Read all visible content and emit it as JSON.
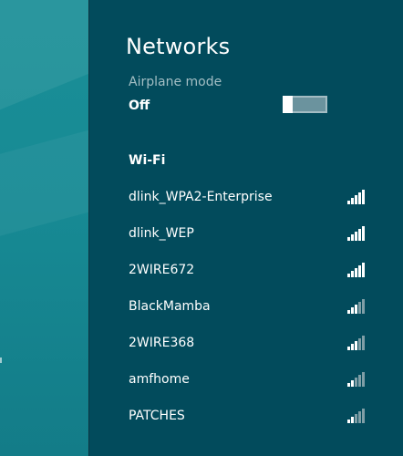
{
  "panel": {
    "title": "Networks",
    "airplane_mode": {
      "label": "Airplane mode",
      "state": "Off",
      "on": false
    },
    "wifi_section": "Wi-Fi",
    "networks": [
      {
        "name": "dlink_WPA2-Enterprise",
        "bars": 5
      },
      {
        "name": "dlink_WEP",
        "bars": 5
      },
      {
        "name": "2WIRE672",
        "bars": 5
      },
      {
        "name": "BlackMamba",
        "bars": 3
      },
      {
        "name": "2WIRE368",
        "bars": 3
      },
      {
        "name": "amfhome",
        "bars": 2
      },
      {
        "name": "PATCHES",
        "bars": 2
      }
    ]
  },
  "icons": {
    "signal": "wifi-signal-icon"
  },
  "colors": {
    "desktop_bg": "#178a94",
    "charm_bg": "#024b5c",
    "text": "#ffffff",
    "muted_text": "#a3bec4",
    "signal_active": "#ffffff",
    "signal_inactive": "#7f9ea6"
  }
}
